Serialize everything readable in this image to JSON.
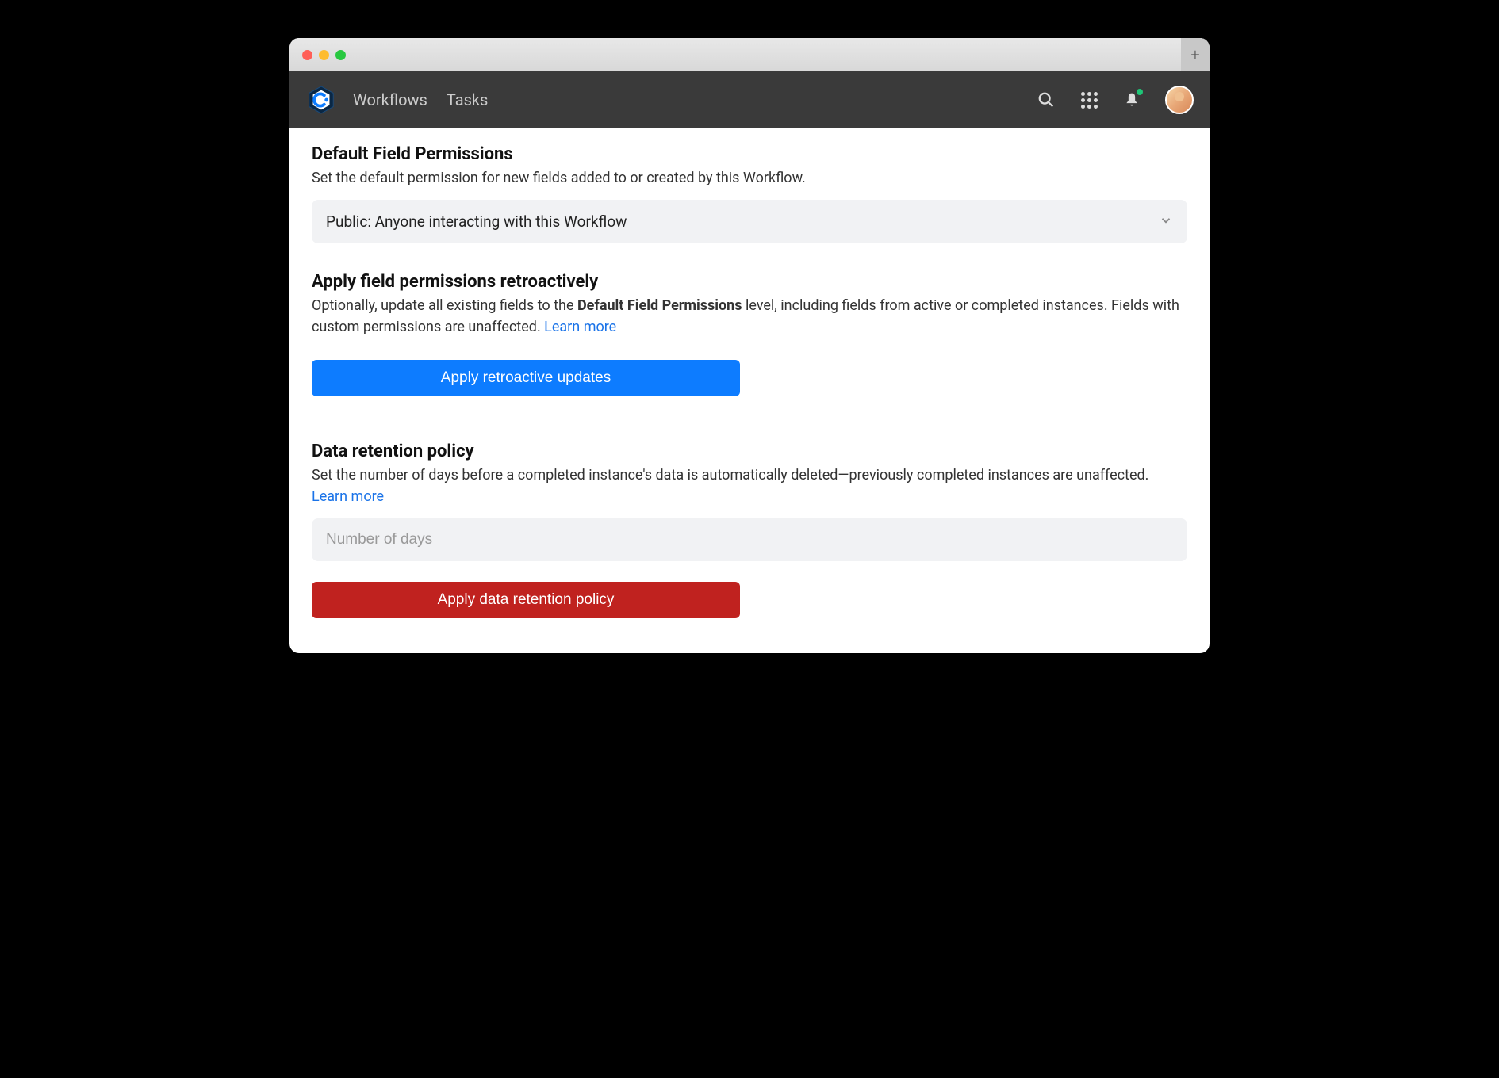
{
  "nav": {
    "workflows": "Workflows",
    "tasks": "Tasks"
  },
  "sections": {
    "defaultPermissions": {
      "title": "Default Field Permissions",
      "desc": "Set the default permission for new fields added to or created by this Workflow.",
      "dropdownValue": "Public: Anyone interacting with this Workflow"
    },
    "applyRetro": {
      "title": "Apply field permissions retroactively",
      "descPrefix": "Optionally, update all existing fields to the ",
      "descBold": "Default Field Permissions",
      "descSuffix": " level, including fields from active or completed instances. Fields with custom permissions are unaffected. ",
      "learnMore": "Learn more",
      "button": "Apply retroactive updates"
    },
    "dataRetention": {
      "title": "Data retention policy",
      "desc": "Set the number of days before a completed instance's data is automatically deleted—previously completed instances are unaffected. ",
      "learnMore": "Learn more",
      "placeholder": "Number of days",
      "button": "Apply data retention policy"
    }
  }
}
